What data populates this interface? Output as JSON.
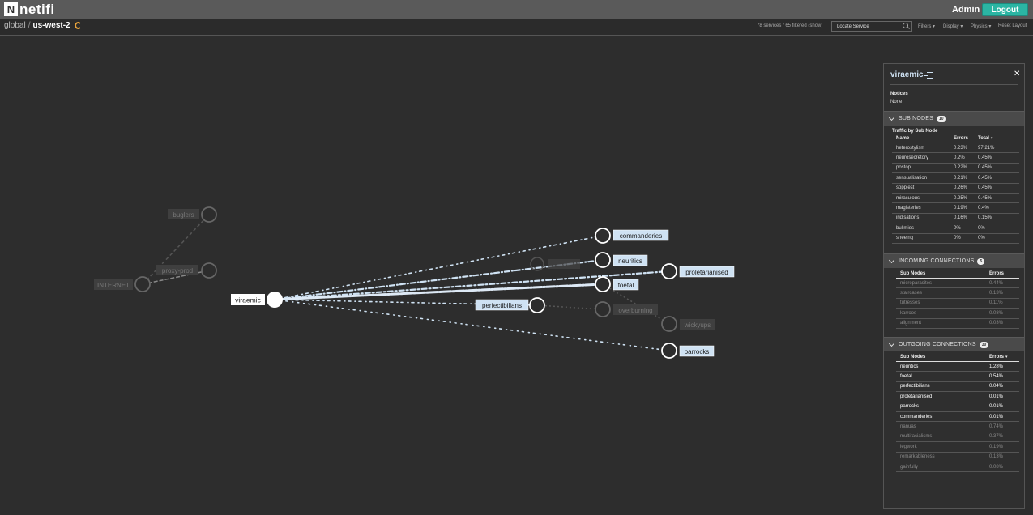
{
  "header": {
    "logo_mark": "N",
    "logo_text": "netifi",
    "user": "Admin",
    "logout_label": "Logout"
  },
  "breadcrumb": {
    "root": "global",
    "separator": "/",
    "region": "us-west-2"
  },
  "toolbar": {
    "counts": "78 services / 65 filtered",
    "show_link": "(show)",
    "locate_placeholder": "Locate Service",
    "filters": "Filters",
    "display": "Display",
    "physics": "Physics",
    "reset": "Reset Layout"
  },
  "graph": {
    "focus": "viraemic",
    "active_nodes": [
      {
        "id": "commanderies",
        "label": "commanderies"
      },
      {
        "id": "neuritics",
        "label": "neuritics"
      },
      {
        "id": "proletarianised",
        "label": "proletarianised"
      },
      {
        "id": "foetal",
        "label": "foetal"
      },
      {
        "id": "perfectibilians",
        "label": "perfectibilians"
      },
      {
        "id": "parrocks",
        "label": "parrocks"
      }
    ],
    "dim_nodes": [
      {
        "id": "buglers",
        "label": "buglers"
      },
      {
        "id": "proxy-prod",
        "label": "proxy-prod"
      },
      {
        "id": "internet",
        "label": "INTERNET"
      },
      {
        "id": "overburning",
        "label": "overburning"
      },
      {
        "id": "wickyups",
        "label": "wickyups"
      }
    ]
  },
  "panel": {
    "title": "viraemic",
    "notices_label": "Notices",
    "notices_value": "None",
    "sub_nodes": {
      "title": "SUB NODES",
      "count": "10",
      "caption": "Traffic by Sub Node",
      "headers": {
        "name": "Name",
        "errors": "Errors",
        "total": "Total"
      },
      "rows": [
        {
          "name": "heterostylism",
          "errors": "0.23%",
          "total": "97.21%"
        },
        {
          "name": "neurosecretory",
          "errors": "0.2%",
          "total": "0.45%"
        },
        {
          "name": "postop",
          "errors": "0.22%",
          "total": "0.45%"
        },
        {
          "name": "sensualisation",
          "errors": "0.21%",
          "total": "0.45%"
        },
        {
          "name": "soppiest",
          "errors": "0.26%",
          "total": "0.45%"
        },
        {
          "name": "miraculous",
          "errors": "0.25%",
          "total": "0.45%"
        },
        {
          "name": "magisteries",
          "errors": "0.19%",
          "total": "0.4%"
        },
        {
          "name": "iridisations",
          "errors": "0.16%",
          "total": "0.15%"
        },
        {
          "name": "bulimies",
          "errors": "0%",
          "total": "0%"
        },
        {
          "name": "sneeing",
          "errors": "0%",
          "total": "0%"
        }
      ]
    },
    "incoming": {
      "title": "INCOMING CONNECTIONS",
      "count": "5",
      "headers": {
        "name": "Sub Nodes",
        "errors": "Errors"
      },
      "rows": [
        {
          "name": "microparasites",
          "errors": "0.44%"
        },
        {
          "name": "staircases",
          "errors": "0.13%"
        },
        {
          "name": "tutresses",
          "errors": "0.11%"
        },
        {
          "name": "karroos",
          "errors": "0.08%"
        },
        {
          "name": "alignment",
          "errors": "0.03%"
        }
      ]
    },
    "outgoing": {
      "title": "OUTGOING CONNECTIONS",
      "count": "30",
      "headers": {
        "name": "Sub Nodes",
        "errors": "Errors"
      },
      "rows": [
        {
          "name": "neuritics",
          "errors": "1.28%",
          "active": true
        },
        {
          "name": "foetal",
          "errors": "0.54%",
          "active": true
        },
        {
          "name": "perfectibilians",
          "errors": "0.04%",
          "active": true
        },
        {
          "name": "proletarianised",
          "errors": "0.01%",
          "active": true
        },
        {
          "name": "parrocks",
          "errors": "0.01%",
          "active": true
        },
        {
          "name": "commanderies",
          "errors": "0.01%",
          "active": true
        },
        {
          "name": "nanuas",
          "errors": "0.74%",
          "active": false
        },
        {
          "name": "multiracialisms",
          "errors": "0.37%",
          "active": false
        },
        {
          "name": "legwork",
          "errors": "0.19%",
          "active": false
        },
        {
          "name": "remarkableness",
          "errors": "0.13%",
          "active": false
        },
        {
          "name": "gainfully",
          "errors": "0.08%",
          "active": false
        }
      ]
    }
  },
  "colors": {
    "accent": "#2bb5a3",
    "label_active": "#cfe2f3",
    "refresh": "#e6a23c"
  }
}
